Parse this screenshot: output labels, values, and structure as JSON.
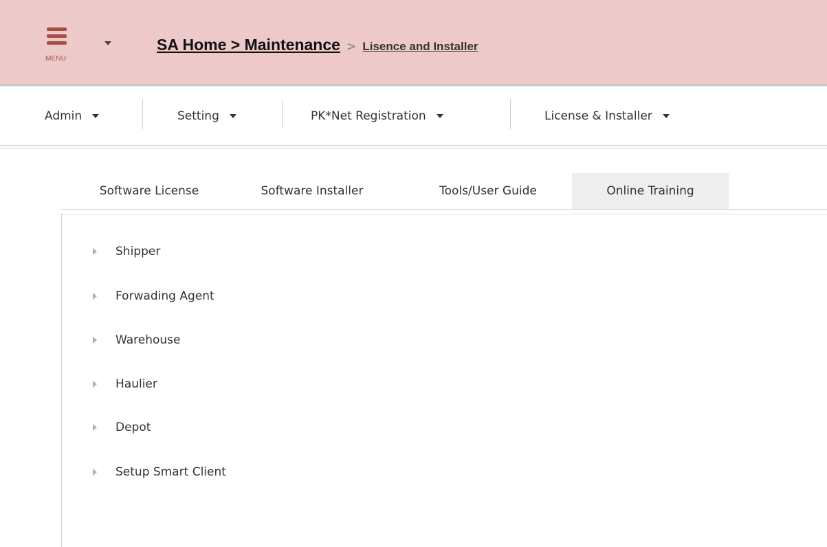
{
  "header": {
    "menu_label": "MENU",
    "breadcrumb_home": "SA Home > Maintenance",
    "breadcrumb_sep": ">",
    "breadcrumb_current": "Lisence and Installer",
    "accent_color": "#a84d42",
    "background_color": "#eec9c9"
  },
  "navbar": {
    "items": [
      {
        "label": "Admin",
        "icon": "caret-down-icon"
      },
      {
        "label": "Setting",
        "icon": "caret-down-icon"
      },
      {
        "label": "PK*Net Registration",
        "icon": "caret-down-icon"
      },
      {
        "label": "License & Installer",
        "icon": "caret-down-icon"
      }
    ]
  },
  "tabs": {
    "items": [
      {
        "label": "Software License"
      },
      {
        "label": "Software Installer"
      },
      {
        "label": "Tools/User Guide"
      },
      {
        "label": "Online Training"
      }
    ],
    "active": "Online Training"
  },
  "tree": {
    "items": [
      {
        "label": "Shipper",
        "icon": "expand-arrow-icon"
      },
      {
        "label": "Forwading Agent",
        "icon": "expand-arrow-icon"
      },
      {
        "label": "Warehouse",
        "icon": "expand-arrow-icon"
      },
      {
        "label": "Haulier",
        "icon": "expand-arrow-icon"
      },
      {
        "label": "Depot",
        "icon": "expand-arrow-icon"
      },
      {
        "label": "Setup Smart Client",
        "icon": "expand-arrow-icon"
      }
    ]
  }
}
